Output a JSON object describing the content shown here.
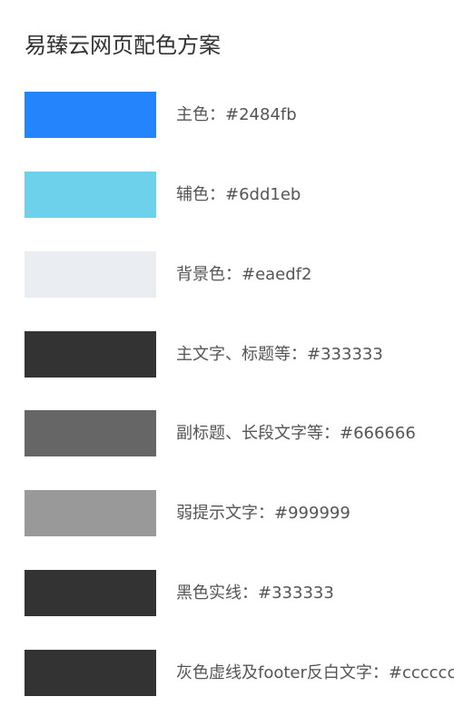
{
  "page": {
    "title": "易臻云网页配色方案"
  },
  "swatches": [
    {
      "label": "主色：#2484fb",
      "color": "#2484fb"
    },
    {
      "label": "辅色：#6dd1eb",
      "color": "#6dd1eb"
    },
    {
      "label": "背景色：#eaedf2",
      "color": "#eaedf2"
    },
    {
      "label": "主文字、标题等：#333333",
      "color": "#333333"
    },
    {
      "label": "副标题、长段文字等：#666666",
      "color": "#666666"
    },
    {
      "label": "弱提示文字：#999999",
      "color": "#999999"
    },
    {
      "label": "黑色实线：#333333",
      "color": "#333333"
    },
    {
      "label": "灰色虚线及footer反白文字：#cccccc",
      "color": "#333333"
    }
  ]
}
